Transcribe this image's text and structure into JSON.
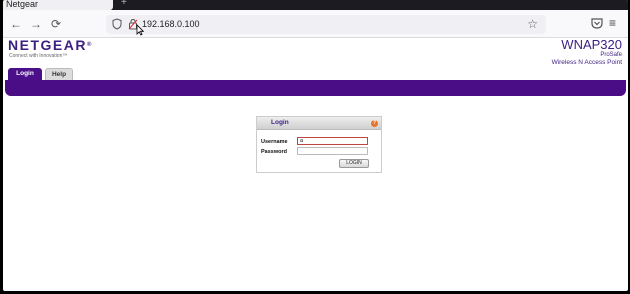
{
  "browser": {
    "tab_title": "Netgear",
    "new_tab": "+",
    "back": "←",
    "forward": "→",
    "reload": "⟳",
    "url": "192.168.0.100",
    "bookmark_star": "☆",
    "menu": "≡"
  },
  "header": {
    "logo": "NETGEAR",
    "logo_mark": "®",
    "tagline": "Connect with Innovation™",
    "model": "WNAP320",
    "product_line": "ProSafe",
    "product_desc": "Wireless N Access Point"
  },
  "tabs": [
    {
      "label": "Login"
    },
    {
      "label": "Help"
    }
  ],
  "login": {
    "title": "Login",
    "help_icon": "?",
    "username_label": "Username",
    "username_value": "a",
    "password_label": "Password",
    "password_value": "",
    "button": "LOGIN"
  },
  "colors": {
    "brand_purple": "#4a0d86",
    "logo_purple": "#3b1f82",
    "help_orange": "#e8732e",
    "focus_red": "#c0453f"
  }
}
